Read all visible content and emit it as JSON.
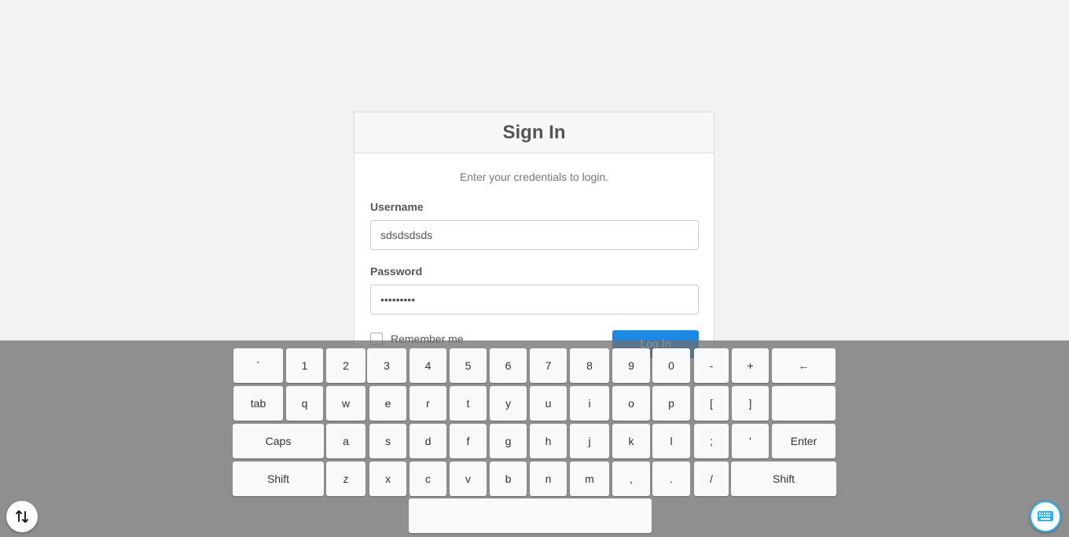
{
  "signin": {
    "title": "Sign In",
    "subtitle": "Enter your credentials to login.",
    "username_label": "Username",
    "username_value": "sdsdsdsds",
    "password_label": "Password",
    "password_value": "•••••••••",
    "remember_label": "Remember me",
    "login_label": "Log In"
  },
  "keyboard": {
    "row1": [
      "`",
      "1",
      "2",
      "3",
      "4",
      "5",
      "6",
      "7",
      "8",
      "9",
      "0",
      "-",
      "+",
      "←"
    ],
    "row2": [
      "tab",
      "q",
      "w",
      "e",
      "r",
      "t",
      "y",
      "u",
      "i",
      "o",
      "p",
      "[",
      "]",
      ""
    ],
    "row3": [
      "Caps",
      "a",
      "s",
      "d",
      "f",
      "g",
      "h",
      "j",
      "k",
      "l",
      ";",
      "'",
      "Enter"
    ],
    "row4": [
      "Shift",
      "z",
      "x",
      "c",
      "v",
      "b",
      "n",
      "m",
      ",",
      ".",
      "/",
      "Shift"
    ],
    "space": ""
  },
  "icons": {
    "toggle_position": "swap-vertical-icon",
    "keyboard_toggle": "keyboard-icon"
  },
  "colors": {
    "accent": "#1e88e5",
    "keyboard_toggle": "#29b6f6"
  }
}
